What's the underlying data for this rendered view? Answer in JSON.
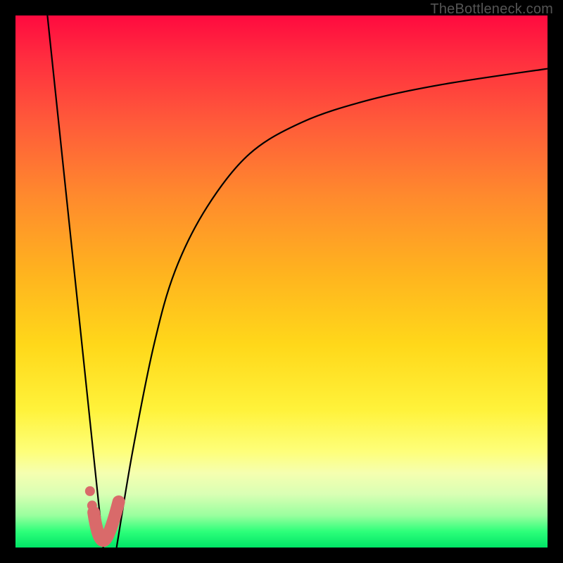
{
  "watermark": "TheBottleneck.com",
  "colors": {
    "frame_bg_top": "#ff0a3f",
    "frame_bg_bottom": "#00e566",
    "curve": "#000000",
    "marker": "#d96a6a",
    "page_bg": "#000000",
    "watermark_text": "#555555"
  },
  "chart_data": {
    "type": "line",
    "title": "",
    "xlabel": "",
    "ylabel": "",
    "xlim": [
      0,
      100
    ],
    "ylim": [
      0,
      100
    ],
    "grid": false,
    "legend": false,
    "series": [
      {
        "name": "left-falling-line",
        "x": [
          6,
          16.5
        ],
        "y": [
          100,
          0
        ]
      },
      {
        "name": "saturating-curve",
        "x": [
          19,
          22,
          26,
          30,
          36,
          44,
          54,
          66,
          80,
          100
        ],
        "y": [
          0,
          18,
          38,
          52,
          64,
          74,
          80,
          84,
          87,
          90
        ]
      }
    ],
    "markers": {
      "j_shape": {
        "points_xy": [
          [
            14.7,
            6.6
          ],
          [
            15.5,
            1.3
          ],
          [
            17.5,
            1.3
          ],
          [
            19.4,
            8.6
          ]
        ],
        "stroke_width_px": 18
      },
      "dots_xy": [
        [
          14.0,
          10.6
        ],
        [
          14.4,
          7.9
        ]
      ],
      "dot_radius_px": 7
    }
  }
}
